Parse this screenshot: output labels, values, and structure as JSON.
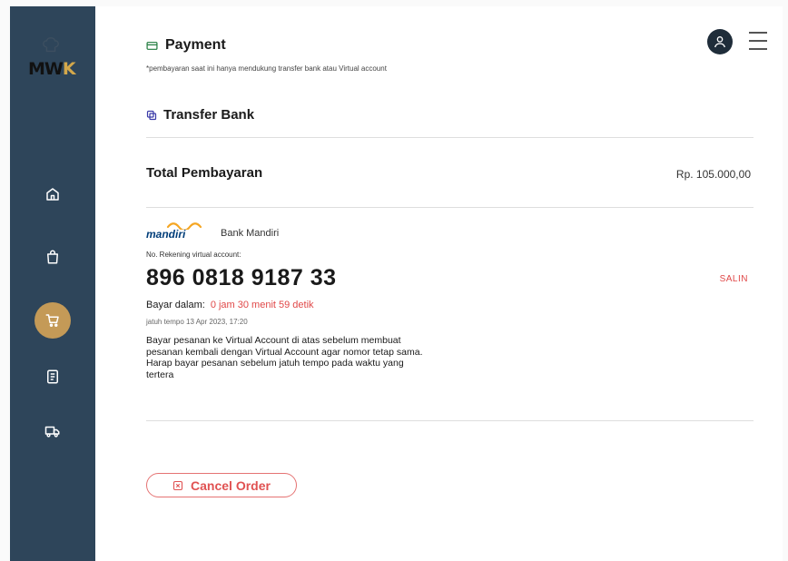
{
  "brand": {
    "logo_text_dark": "MW",
    "logo_text_accent": "K"
  },
  "sidebar": {
    "items": [
      {
        "label": "home",
        "icon": "home-icon"
      },
      {
        "label": "shopping bag",
        "icon": "bag-icon"
      },
      {
        "label": "cart",
        "icon": "cart-icon"
      },
      {
        "label": "orders",
        "icon": "document-icon"
      },
      {
        "label": "delivery",
        "icon": "truck-icon"
      }
    ],
    "active": "cart"
  },
  "header": {
    "title": "Payment",
    "note": "*pembayaran saat ini hanya mendukung transfer bank atau Virtual account"
  },
  "payment": {
    "method": "Transfer Bank",
    "total_label": "Total Pembayaran",
    "total_amount": "Rp. 105.000,00",
    "bank_logo_text": "mandiri",
    "bank_name": "Bank Mandiri",
    "va_label": "No. Rekening virtual account:",
    "va_number": "896 0818 9187 33",
    "copy_label": "SALIN",
    "pay_within_label": "Bayar dalam:",
    "countdown": "0 jam 30 menit 59 detik",
    "due_date": "jatuh tempo 13 Apr 2023, 17:20",
    "instructions": "Bayar pesanan ke Virtual Account di atas sebelum membuat pesanan kembali dengan Virtual Account agar nomor tetap sama. Harap bayar pesanan sebelum jatuh tempo pada waktu yang tertera"
  },
  "actions": {
    "cancel_label": "Cancel Order"
  },
  "colors": {
    "sidebar_bg": "#2e455a",
    "accent_gold": "#c49a57",
    "danger": "#e04848",
    "avatar_bg": "#1f2d3a",
    "mandiri_blue": "#003d79",
    "mandiri_gold": "#f5a623"
  }
}
